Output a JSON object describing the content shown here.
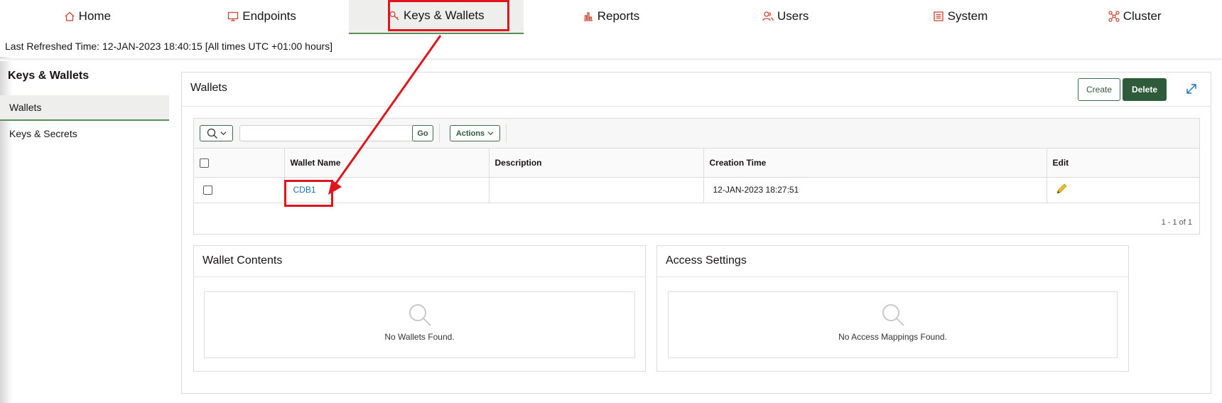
{
  "nav": {
    "tabs": [
      {
        "label": "Home",
        "icon": "home-icon"
      },
      {
        "label": "Endpoints",
        "icon": "monitor-icon"
      },
      {
        "label": "Keys & Wallets",
        "icon": "key-icon"
      },
      {
        "label": "Reports",
        "icon": "bar-chart-icon"
      },
      {
        "label": "Users",
        "icon": "users-icon"
      },
      {
        "label": "System",
        "icon": "system-icon"
      },
      {
        "label": "Cluster",
        "icon": "cluster-icon"
      }
    ],
    "active_tab": "Keys & Wallets",
    "accent_color": "#c74634"
  },
  "refresh": {
    "text": "Last Refreshed Time: 12-JAN-2023 18:40:15 [All times UTC +01:00 hours]"
  },
  "sidebar": {
    "title": "Keys & Wallets",
    "items": [
      {
        "label": "Wallets",
        "active": true
      },
      {
        "label": "Keys & Secrets",
        "active": false
      }
    ]
  },
  "wallets_panel": {
    "title": "Wallets",
    "create_label": "Create",
    "delete_label": "Delete",
    "toolbar": {
      "search_placeholder": "",
      "go_label": "Go",
      "actions_label": "Actions"
    },
    "columns": [
      "Wallet Name",
      "Description",
      "Creation Time",
      "Edit"
    ],
    "rows": [
      {
        "wallet_name": "CDB1",
        "description": "",
        "creation_time": "12-JAN-2023 18:27:51"
      }
    ],
    "pagination": "1 - 1 of 1"
  },
  "wallet_contents": {
    "title": "Wallet Contents",
    "empty_text": "No Wallets Found."
  },
  "access_settings": {
    "title": "Access Settings",
    "empty_text": "No Access Mappings Found."
  },
  "colors": {
    "primary_green": "#2e5c3b",
    "link_blue": "#1f6fb2",
    "annotation_red": "#e0141c"
  }
}
